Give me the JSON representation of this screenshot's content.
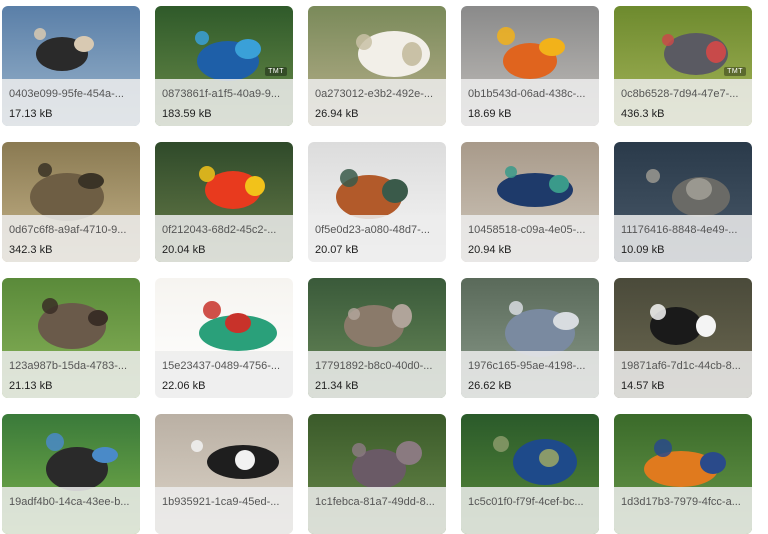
{
  "gallery": {
    "items": [
      {
        "filename": "0403e099-95fe-454a-...",
        "size": "17.13 kB",
        "colors": [
          "#5a7fa8",
          "#9bb5cc",
          "#2a2a2a",
          "#d8c9b2"
        ]
      },
      {
        "filename": "0873861f-a1f5-40a9-9...",
        "size": "183.59 kB",
        "colors": [
          "#2f5a2a",
          "#6b8c4a",
          "#1e5fa8",
          "#3aa0d8"
        ]
      },
      {
        "filename": "0a273012-e3b2-492e-...",
        "size": "26.94 kB",
        "colors": [
          "#7a8a5a",
          "#b8b08c",
          "#f2efe8",
          "#c9c1a6"
        ]
      },
      {
        "filename": "0b1b543d-06ad-438c-...",
        "size": "18.69 kB",
        "colors": [
          "#8a8a8a",
          "#c3c0bc",
          "#e0641e",
          "#f2b21a"
        ]
      },
      {
        "filename": "0c8b6528-7d94-47e7-...",
        "size": "436.3 kB",
        "colors": [
          "#6d8a2e",
          "#a6b55a",
          "#5a5a62",
          "#c84a4a"
        ]
      },
      {
        "filename": "0d67c6f8-a9af-4710-9...",
        "size": "342.3 kB",
        "colors": [
          "#8a7a52",
          "#c6b48a",
          "#6e5e44",
          "#3a3326"
        ]
      },
      {
        "filename": "0f212043-68d2-45c2-...",
        "size": "20.04 kB",
        "colors": [
          "#2f4a2a",
          "#6a7e4a",
          "#e83a1e",
          "#f2c21a"
        ]
      },
      {
        "filename": "0f5e0d23-a080-48d7-...",
        "size": "20.07 kB",
        "colors": [
          "#dcdcdc",
          "#f6f6f6",
          "#b25a2a",
          "#3a5a4a"
        ]
      },
      {
        "filename": "10458518-c09a-4e05-...",
        "size": "20.94 kB",
        "colors": [
          "#a89a8a",
          "#d0c8bc",
          "#1e3a6a",
          "#3a9a8a"
        ]
      },
      {
        "filename": "11176416-8848-4e49-...",
        "size": "10.09 kB",
        "colors": [
          "#2a3a4a",
          "#4a5a6a",
          "#6a6a66",
          "#9a9890"
        ]
      },
      {
        "filename": "123a987b-15da-4783-...",
        "size": "21.13 kB",
        "colors": [
          "#5a8a3a",
          "#8ab45a",
          "#6a5a4a",
          "#3a2e26"
        ]
      },
      {
        "filename": "15e23437-0489-4756-...",
        "size": "22.06 kB",
        "colors": [
          "#f6f4f0",
          "#ffffff",
          "#2aa07a",
          "#c8322a"
        ]
      },
      {
        "filename": "17791892-b8c0-40d0-...",
        "size": "21.34 kB",
        "colors": [
          "#3a5a3a",
          "#6a8a5a",
          "#8a7a6a",
          "#b0a49a"
        ]
      },
      {
        "filename": "1976c165-95ae-4198-...",
        "size": "26.62 kB",
        "colors": [
          "#5a6a5a",
          "#8a9a8a",
          "#7a8aa0",
          "#d8dce0"
        ]
      },
      {
        "filename": "19871af6-7d1c-44cb-8...",
        "size": "14.57 kB",
        "colors": [
          "#4a4a3a",
          "#6e6a52",
          "#1a1a1a",
          "#f4f4f4"
        ]
      },
      {
        "filename": "19adf4b0-14ca-43ee-b...",
        "size": "",
        "colors": [
          "#3a7a3a",
          "#7ab04a",
          "#2a2a2a",
          "#4a8ac8"
        ]
      },
      {
        "filename": "1b935921-1ca9-45ed-...",
        "size": "",
        "colors": [
          "#bab0a4",
          "#dcd4c8",
          "#1e1e1e",
          "#f2f2f2"
        ]
      },
      {
        "filename": "1c1febca-81a7-49dd-8...",
        "size": "",
        "colors": [
          "#3a5a2a",
          "#6a8a4a",
          "#6a5a66",
          "#8a7a80"
        ]
      },
      {
        "filename": "1c5c01f0-f79f-4cef-bc...",
        "size": "",
        "colors": [
          "#2a5a2a",
          "#5a8a3a",
          "#1e4a8a",
          "#8a9a6a"
        ]
      },
      {
        "filename": "1d3d17b3-7979-4fcc-a...",
        "size": "",
        "colors": [
          "#3a6a2a",
          "#6a9a4a",
          "#e07a1e",
          "#2a4a8a"
        ]
      }
    ],
    "badge_text": "TMT"
  }
}
